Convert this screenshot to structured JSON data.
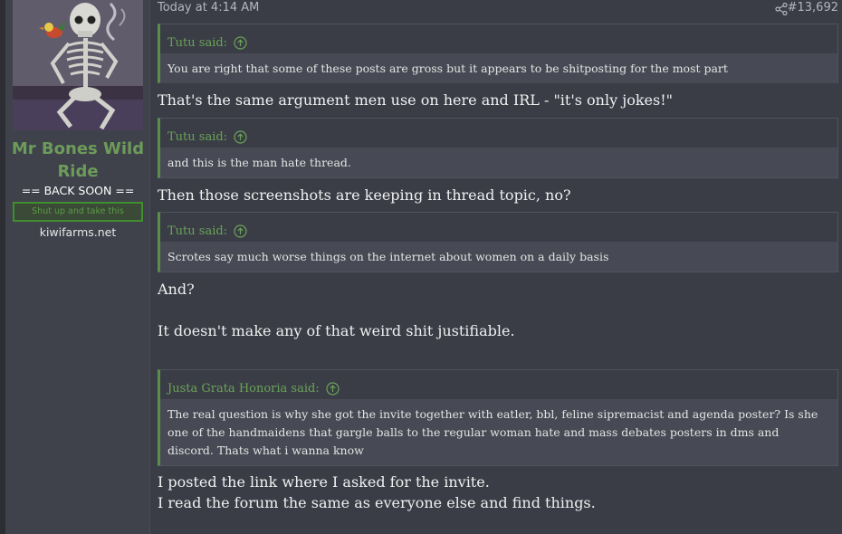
{
  "author": {
    "username": "Mr Bones Wild Ride",
    "title": "== BACK SOON ==",
    "banner": "Shut up and take this",
    "site": "kiwifarms.net",
    "avatar_icon": "skeleton-avatar"
  },
  "post": {
    "time": "Today at 4:14 AM",
    "number": "#13,692",
    "share_icon": "share-icon"
  },
  "content": {
    "quote1": {
      "author": "Tutu said:",
      "text": "You are right that some of these posts are gross but it appears to be shitposting for the most part"
    },
    "reply1": "That's the same argument men use on here and IRL - \"it's only jokes!\"",
    "quote2": {
      "author": "Tutu said:",
      "text": "and this is the man hate thread."
    },
    "reply2": "Then those screenshots are keeping in thread topic, no?",
    "quote3": {
      "author": "Tutu said:",
      "text": "Scrotes say much worse things on the internet about women on a daily basis"
    },
    "reply3a": "And?",
    "reply3b": "It doesn't make any of that weird shit justifiable.",
    "quote4": {
      "author": "Justa Grata Honoria said:",
      "text": "The real question is why she got the invite together with eatler, bbl, feline sipremacist and agenda poster? Is she one of the handmaidens that gargle balls to the regular woman hate and mass debates posters in dms and discord. Thats what i wanna know"
    },
    "reply4a": "I posted the link where I asked for the invite.",
    "reply4b": "I read the forum the same as everyone else and find things."
  },
  "colors": {
    "accent_green": "#6aa358",
    "username_green": "#6d9b5a",
    "background": "#3a3d46",
    "sidebar": "#3f424b"
  }
}
